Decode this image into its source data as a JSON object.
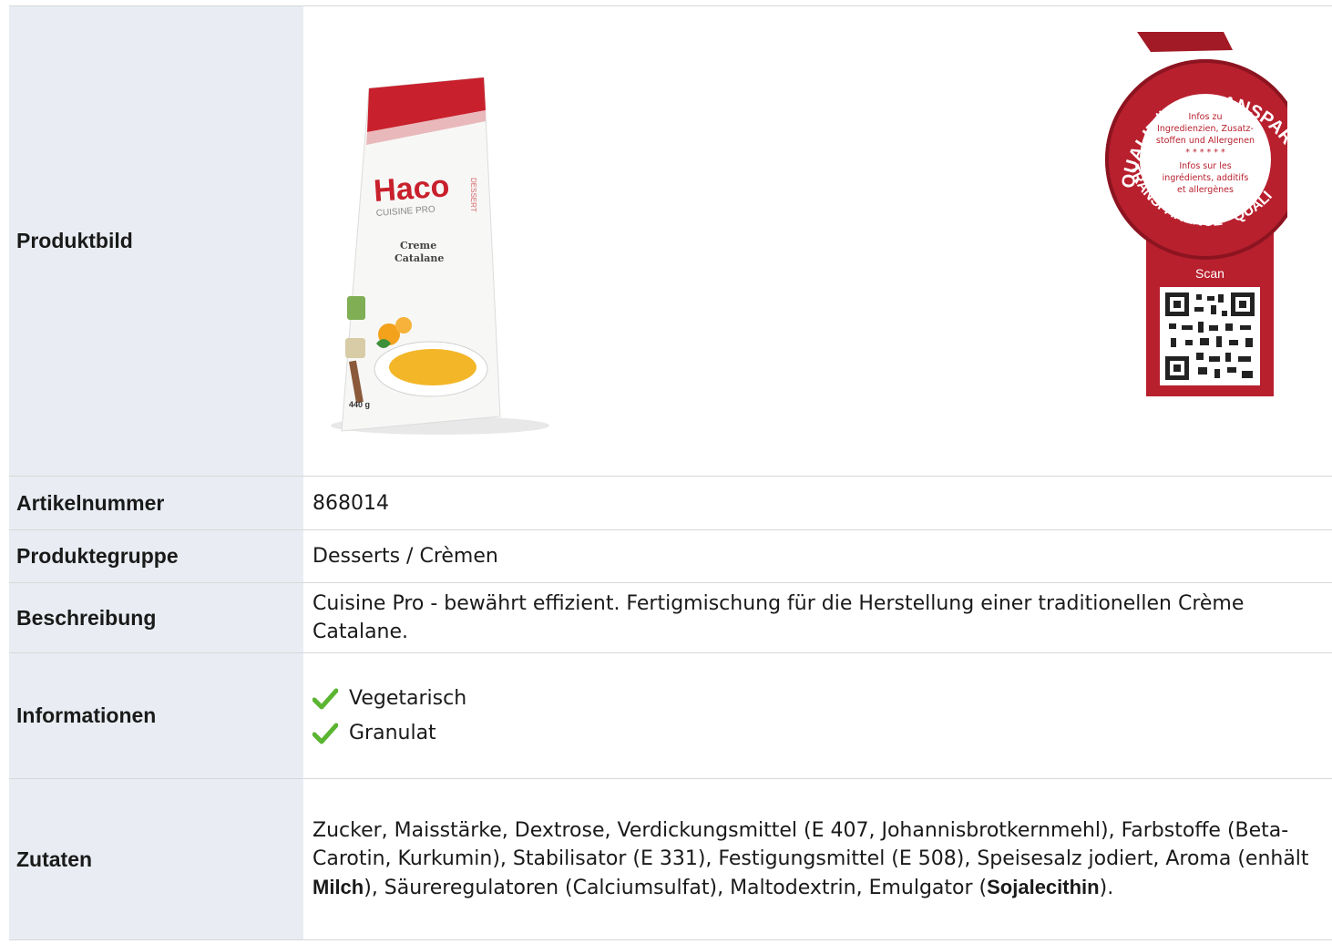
{
  "rows": {
    "image": {
      "label": "Produktbild"
    },
    "article": {
      "label": "Artikelnummer",
      "value": "868014"
    },
    "group": {
      "label": "Produktegruppe",
      "value": "Desserts / Crèmen"
    },
    "description": {
      "label": "Beschreibung",
      "value": "Cuisine Pro - bewährt effizient. Fertigmischung für die Herstellung einer traditionellen Crème Catalane."
    },
    "info": {
      "label": "Informationen",
      "items": [
        "Vegetarisch",
        "Granulat"
      ]
    },
    "ingredients": {
      "label": "Zutaten",
      "part1": "Zucker, Maisstärke, Dextrose, Verdickungsmittel (E 407, Johannisbrotkernmehl), Farbstoffe (Beta-Carotin, Kurkumin), Stabilisator (E 331), Festigungsmittel (E 508), Speisesalz jodiert, Aroma (enhält ",
      "allergen1": "Milch",
      "part2": "), Säureregulatoren (Calciumsulfat), Maltodextrin, Emulgator (",
      "allergen2": "Sojalecithin",
      "part3": ")."
    }
  },
  "package": {
    "brand": "Haco",
    "line": "CUISINE PRO",
    "product_line1": "Creme",
    "product_line2": "Catalane",
    "weight": "440 g",
    "side": "DESSERT"
  },
  "seal": {
    "arc_top": "QUALITÄT - TRANSPARENZ",
    "arc_bottom": "TRANSPARENCE - QUALITÉ",
    "inner_de1": "Infos zu",
    "inner_de2": "Ingredienzien, Zusatz-",
    "inner_de3": "stoffen und Allergenen",
    "stars": "* * * * * *",
    "inner_fr1": "Infos sur les",
    "inner_fr2": "ingrédients, additifs",
    "inner_fr3": "et allergènes",
    "scan": "Scan"
  },
  "colors": {
    "label_bg": "#e9edf3",
    "seal_red": "#b8202e",
    "check_green": "#5bb531",
    "pack_red": "#c8202c"
  }
}
